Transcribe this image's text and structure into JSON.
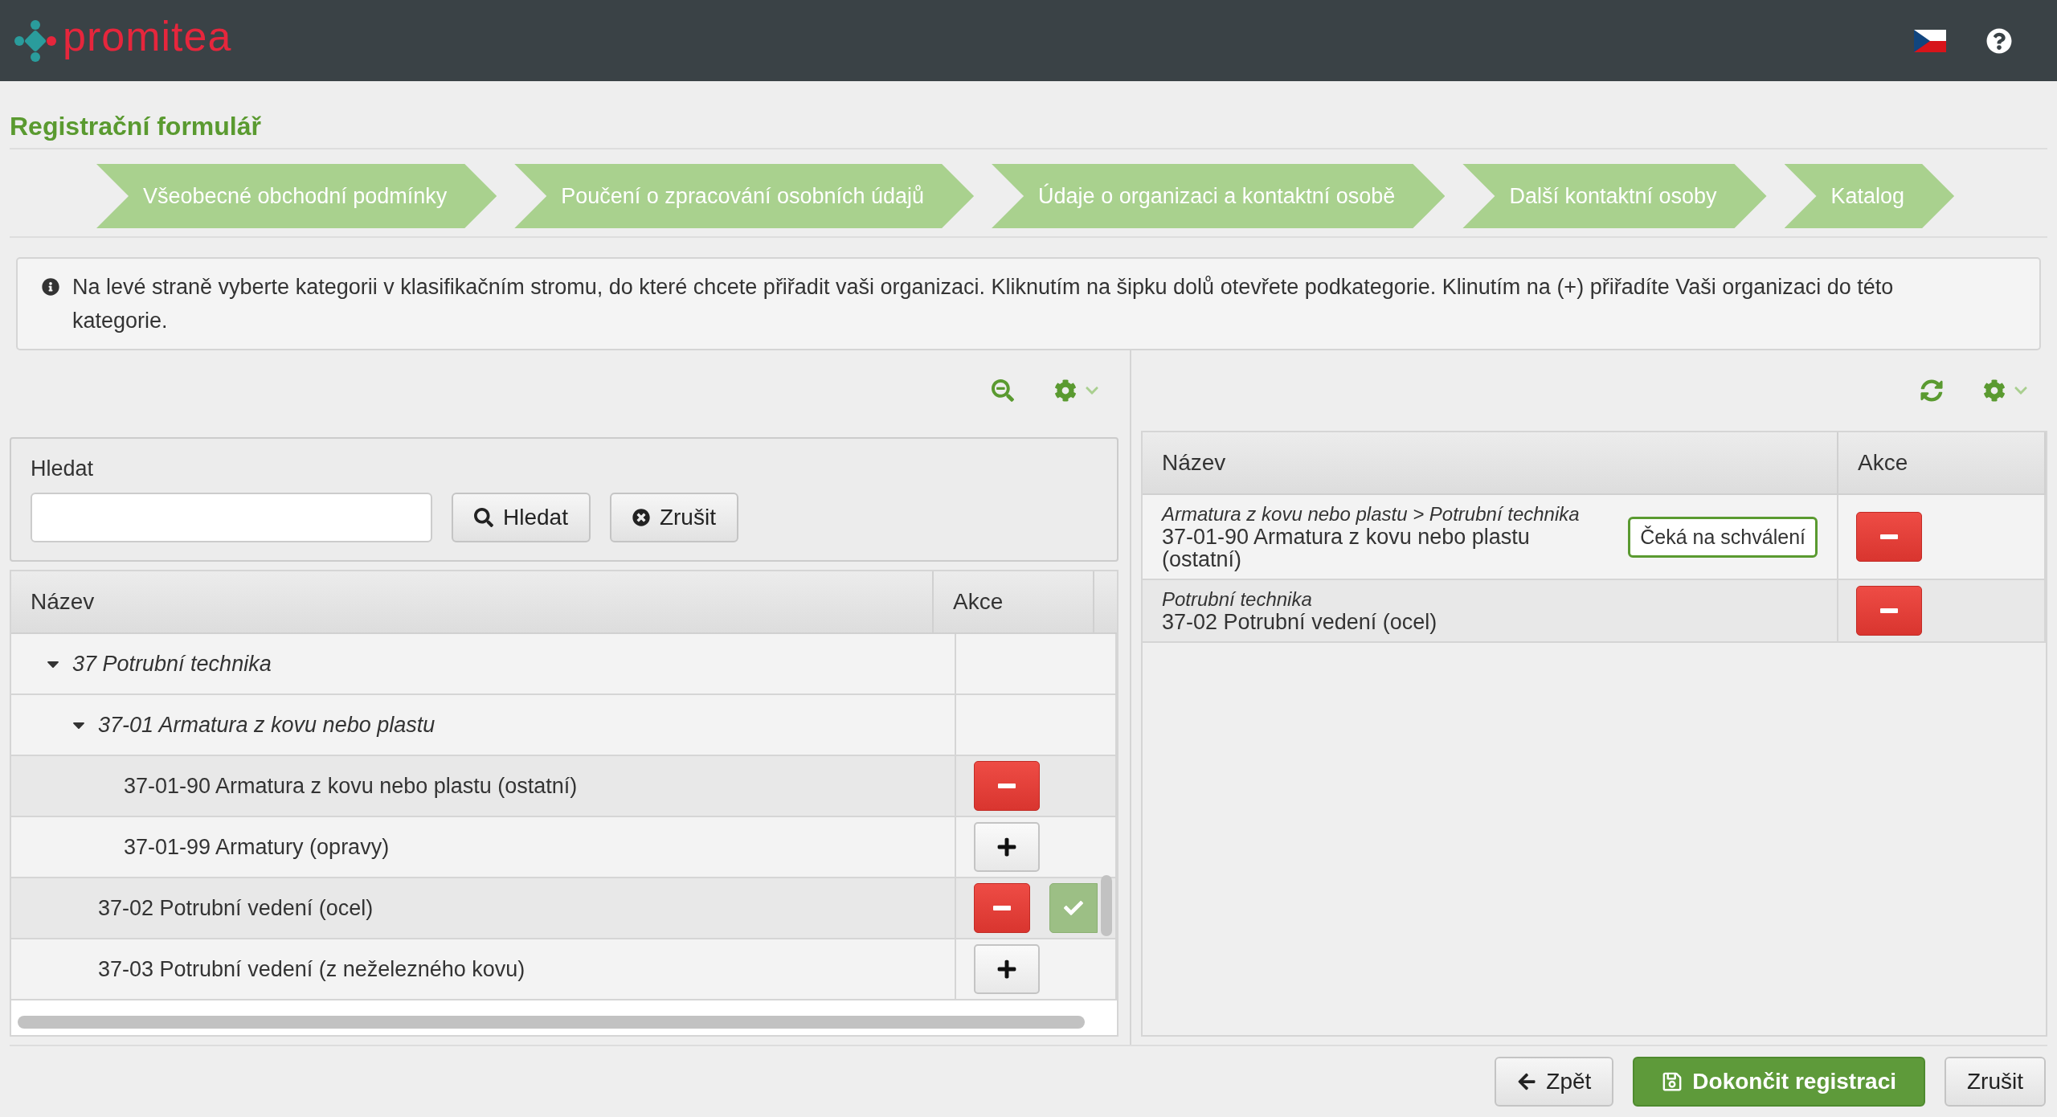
{
  "header": {
    "logo": "promitea"
  },
  "page_title": "Registrační formulář",
  "steps": [
    {
      "label": "Všeobecné obchodní podmínky"
    },
    {
      "label": "Poučení o zpracování osobních údajů"
    },
    {
      "label": "Údaje o organizaci a kontaktní osobě"
    },
    {
      "label": "Další kontaktní osoby"
    },
    {
      "label": "Katalog"
    }
  ],
  "info": "Na levé straně vyberte kategorii v klasifikačním stromu, do které chcete přiřadit vaši organizaci. Kliknutím na šipku dolů otevřete podkategorie. Klinutím na (+) přiřadíte Vaši organizaci do této kategorie.",
  "left": {
    "search": {
      "label": "Hledat",
      "search_button": "Hledat",
      "cancel_button": "Zrušit"
    },
    "table": {
      "columns": [
        "Název",
        "Akce"
      ],
      "rows": [
        {
          "kind": "category",
          "label": "37 Potrubní technika",
          "expanded": true,
          "children": [
            {
              "kind": "category",
              "label": "37-01 Armatura z kovu nebo plastu",
              "expanded": true,
              "children": [
                {
                  "kind": "item",
                  "label": "37-01-90 Armatura z kovu nebo plastu (ostatní)",
                  "assigned": true,
                  "approved": false
                },
                {
                  "kind": "item",
                  "label": "37-01-99 Armatury (opravy)",
                  "assigned": false,
                  "approved": false
                }
              ]
            },
            {
              "kind": "item",
              "label": "37-02 Potrubní vedení (ocel)",
              "assigned": true,
              "approved": true
            },
            {
              "kind": "item",
              "label": "37-03 Potrubní vedení (z neželezného kovu)",
              "assigned": false,
              "approved": false
            }
          ]
        }
      ]
    }
  },
  "right": {
    "table": {
      "columns": [
        "Název",
        "Akce"
      ],
      "rows": [
        {
          "path": "Armatura z kovu nebo plastu > Potrubní technika",
          "name": "37-01-90 Armatura z kovu nebo plastu (ostatní)",
          "status": "Čeká na schválení"
        },
        {
          "path": "Potrubní technika",
          "name": "37-02 Potrubní vedení (ocel)"
        }
      ]
    }
  },
  "footer": {
    "back": "Zpět",
    "finish": "Dokončit registraci",
    "cancel": "Zrušit"
  }
}
